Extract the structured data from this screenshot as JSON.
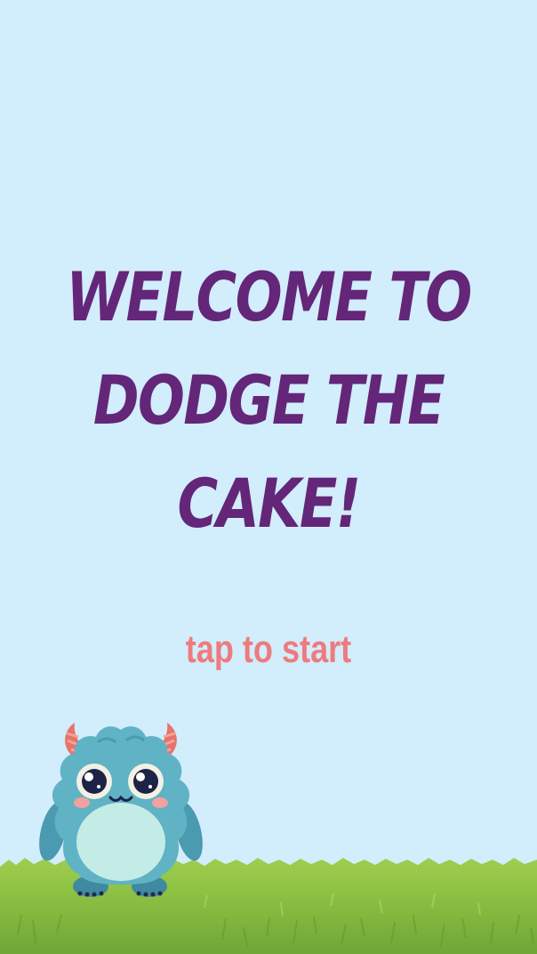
{
  "game": {
    "title_lines": [
      "Welcome to",
      "Dodge the",
      "Cake!"
    ],
    "prompt": "tap to start"
  },
  "player": {
    "icon": "monster-icon"
  },
  "scene": {
    "sky_color": "#d2edfb",
    "title_color": "#642678",
    "prompt_color": "#ee7b7f",
    "ground": "grass",
    "grass_color": "#8ec243"
  }
}
